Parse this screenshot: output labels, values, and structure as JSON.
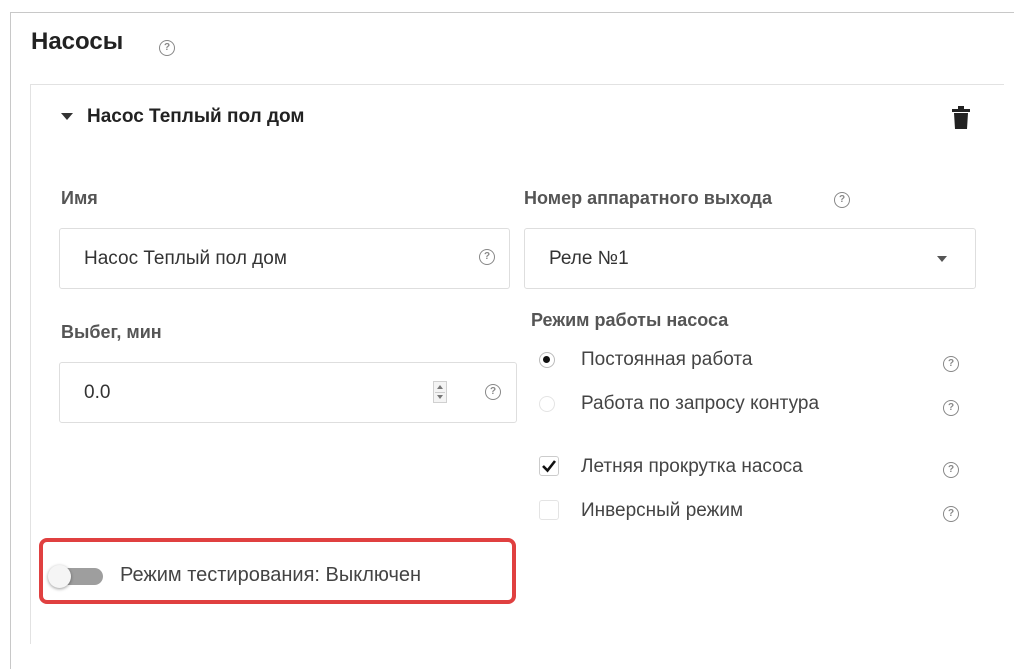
{
  "section": {
    "title": "Насосы",
    "help_icon": "question-circle-icon"
  },
  "pump": {
    "title": "Насос Теплый пол дом",
    "expand_icon": "caret-down-icon",
    "delete_icon": "trash-icon",
    "name_label": "Имя",
    "name_value": "Насос Теплый пол дом",
    "output_label": "Номер аппаратного выхода",
    "output_value": "Реле №1",
    "runout_label": "Выбег, мин",
    "runout_value": "0.0",
    "mode_label": "Режим работы насоса",
    "mode_options": [
      {
        "label": "Постоянная работа",
        "selected": true
      },
      {
        "label": "Работа по запросу контура",
        "selected": false
      }
    ],
    "checkboxes": [
      {
        "label": "Летняя прокрутка насоса",
        "checked": true
      },
      {
        "label": "Инверсный режим",
        "checked": false
      }
    ],
    "test_mode_label": "Режим тестирования: Выключен",
    "test_mode_on": false
  },
  "colors": {
    "highlight": "#e04040",
    "toggle_off": "#9e9e9e"
  }
}
